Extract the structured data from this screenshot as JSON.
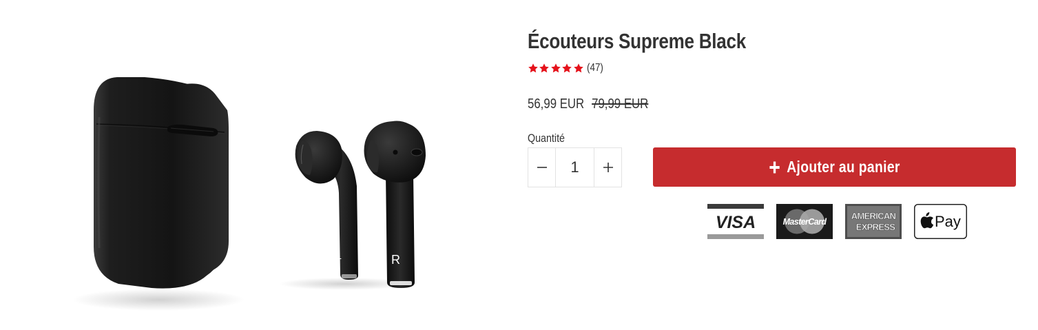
{
  "product": {
    "title": "Écouteurs Supreme Black",
    "review_count": "(47)",
    "rating_stars": 5,
    "price_current": "56,99 EUR",
    "price_old": "79,99 EUR"
  },
  "quantity": {
    "label": "Quantité",
    "value": "1",
    "decrease_icon": "minus-icon",
    "increase_icon": "plus-icon"
  },
  "cart": {
    "add_label": "Ajouter au panier",
    "icon": "plus-icon"
  },
  "earbud_marks": {
    "left": "L",
    "right": "R"
  },
  "payments": [
    {
      "name": "visa-icon",
      "text": "VISA"
    },
    {
      "name": "mastercard-icon",
      "text": "MasterCard"
    },
    {
      "name": "amex-icon",
      "text_line1": "AMERICAN",
      "text_line2": "EXPRESS"
    },
    {
      "name": "apple-pay-icon",
      "text": "Pay"
    }
  ],
  "colors": {
    "accent": "#c62c2e",
    "star": "#e5121b",
    "text": "#333333",
    "border": "#e2e2e2"
  }
}
